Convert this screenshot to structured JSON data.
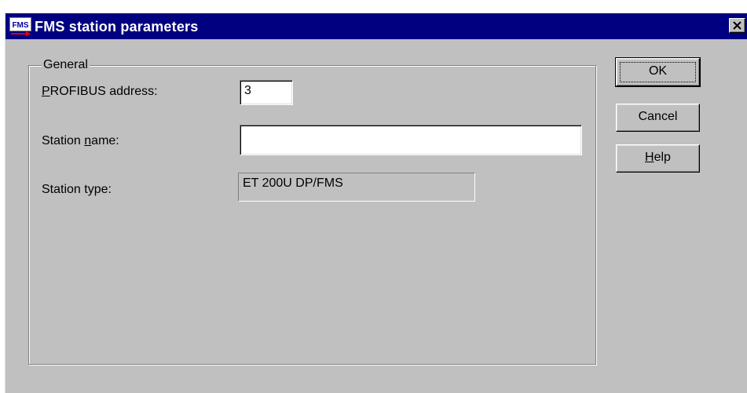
{
  "window": {
    "title": "FMS station parameters",
    "icon": "fms-app-icon",
    "icon_text": "FMS",
    "close_icon": "close-icon"
  },
  "general": {
    "group_label": "General",
    "profibus_address_label": "PROFIBUS address:",
    "profibus_address_value": "3",
    "station_name_label": "Station name:",
    "station_name_value": "",
    "station_type_label": "Station type:",
    "station_type_value": "ET 200U DP/FMS"
  },
  "buttons": {
    "ok": "OK",
    "cancel": "Cancel",
    "help": "Help"
  },
  "colors": {
    "titlebar": "#000080",
    "face": "#c0c0c0",
    "field": "#ffffff"
  }
}
